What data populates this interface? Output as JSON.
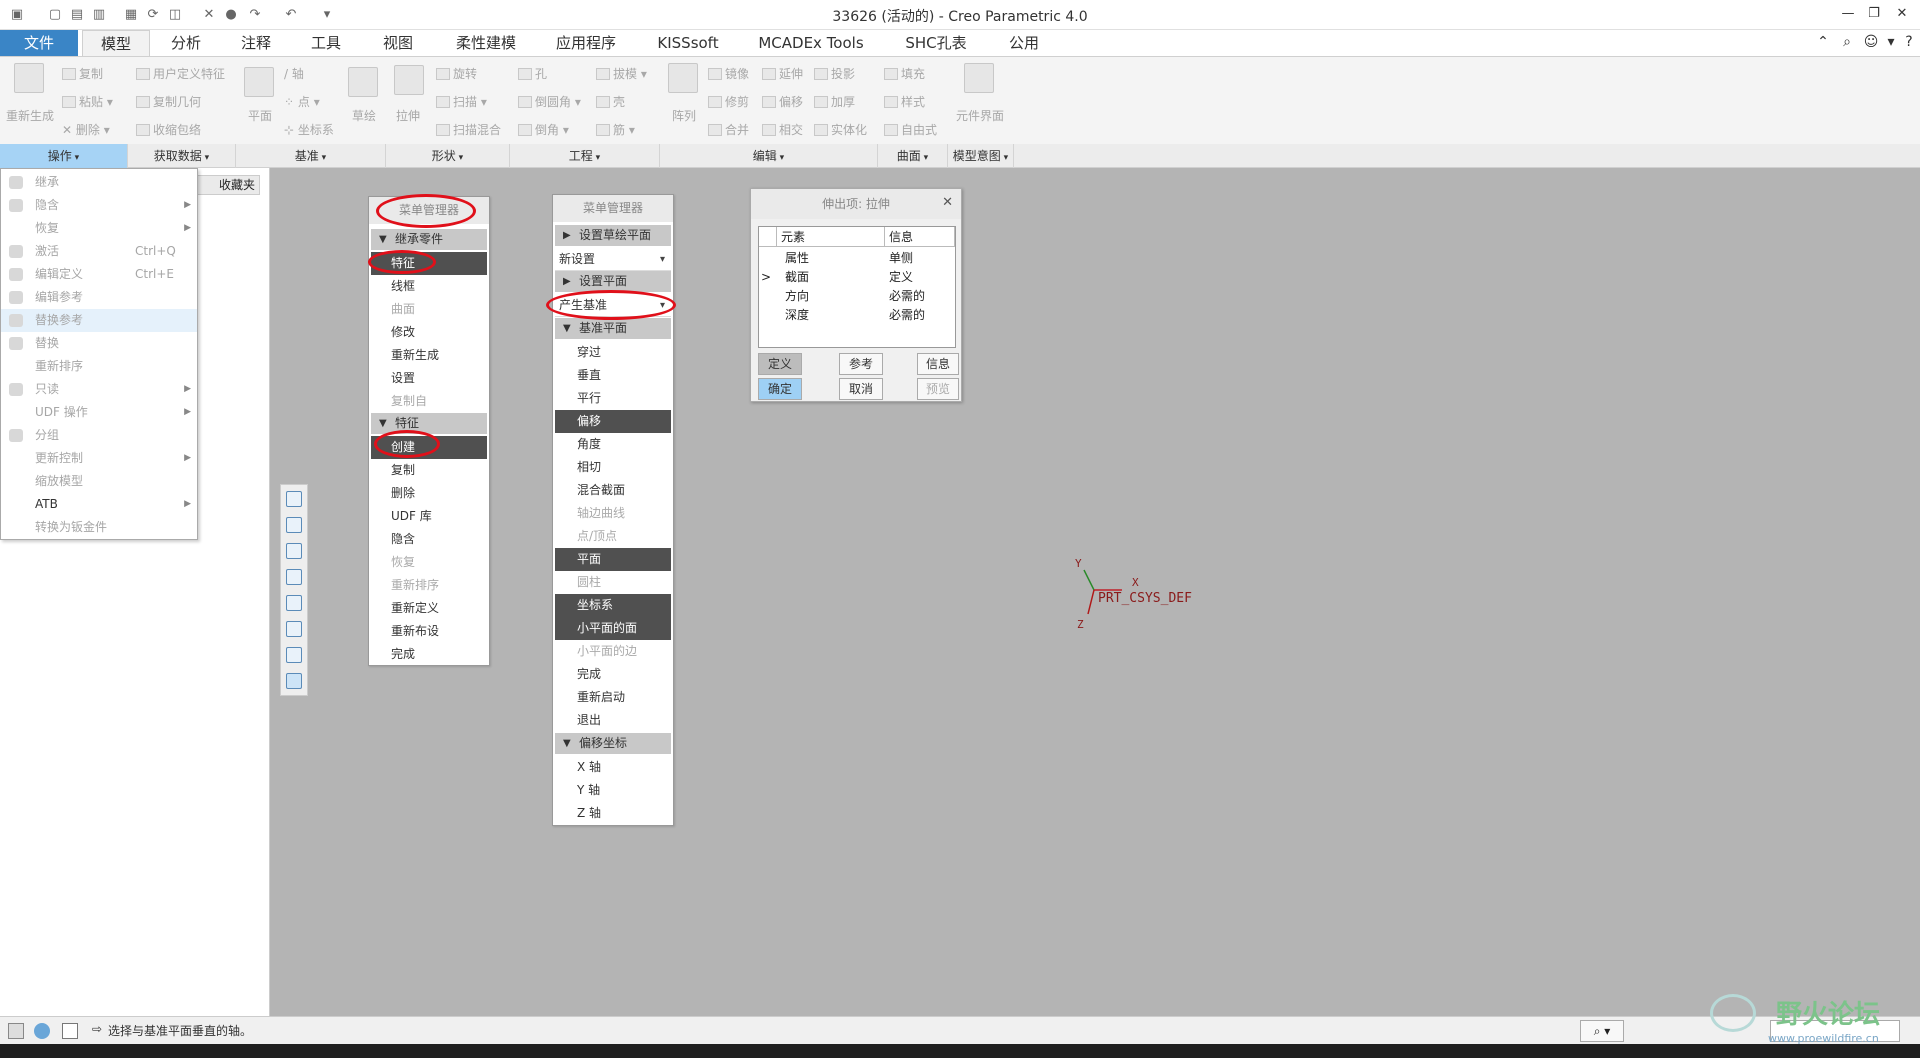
{
  "window": {
    "title": "33626 (活动的) - Creo Parametric 4.0"
  },
  "tabs": [
    "文件",
    "模型",
    "分析",
    "注释",
    "工具",
    "视图",
    "柔性建模",
    "应用程序",
    "KISSsoft",
    "MCADEx Tools",
    "SHC孔表",
    "公用"
  ],
  "ribbon": {
    "regen": "重新生成",
    "copy": "复制",
    "paste": "粘贴",
    "delete": "删除",
    "udf": "用户定义特征",
    "copy_geom": "复制几何",
    "shrinkwrap": "收缩包络",
    "plane": "平面",
    "axis": "轴",
    "point": "点",
    "csys": "坐标系",
    "sketch": "草绘",
    "extrude": "拉伸",
    "revolve": "旋转",
    "sweep": "扫描",
    "swept_blend": "扫描混合",
    "hole": "孔",
    "round": "倒圆角",
    "chamfer": "倒角",
    "draft": "拔模",
    "shell": "壳",
    "rib": "筋",
    "pattern": "阵列",
    "mirror": "镜像",
    "extend": "延伸",
    "project": "投影",
    "trim": "修剪",
    "offset": "偏移",
    "thicken": "加厚",
    "merge": "合并",
    "intersect": "相交",
    "solidify": "实体化",
    "fill": "填充",
    "style": "样式",
    "freestyle": "自由式",
    "comp_interface": "元件界面"
  },
  "groups": [
    "操作",
    "获取数据",
    "基准",
    "形状",
    "工程",
    "编辑",
    "曲面",
    "模型意图"
  ],
  "favorites_tab": "收藏夹",
  "ops_menu": [
    {
      "label": "继承",
      "shortcut": "",
      "arrow": false,
      "enabled": false
    },
    {
      "label": "隐含",
      "shortcut": "",
      "arrow": true,
      "enabled": false
    },
    {
      "label": "恢复",
      "shortcut": "",
      "arrow": true,
      "enabled": false
    },
    {
      "label": "激活",
      "shortcut": "Ctrl+Q",
      "arrow": false,
      "enabled": false
    },
    {
      "label": "编辑定义",
      "shortcut": "Ctrl+E",
      "arrow": false,
      "enabled": false
    },
    {
      "label": "编辑参考",
      "shortcut": "",
      "arrow": false,
      "enabled": false
    },
    {
      "label": "替换参考",
      "shortcut": "",
      "arrow": false,
      "enabled": false
    },
    {
      "label": "替换",
      "shortcut": "",
      "arrow": false,
      "enabled": false
    },
    {
      "label": "重新排序",
      "shortcut": "",
      "arrow": false,
      "enabled": false
    },
    {
      "label": "只读",
      "shortcut": "",
      "arrow": true,
      "enabled": false
    },
    {
      "label": "UDF 操作",
      "shortcut": "",
      "arrow": true,
      "enabled": false
    },
    {
      "label": "分组",
      "shortcut": "",
      "arrow": false,
      "enabled": false
    },
    {
      "label": "更新控制",
      "shortcut": "",
      "arrow": true,
      "enabled": false
    },
    {
      "label": "缩放模型",
      "shortcut": "",
      "arrow": false,
      "enabled": false
    },
    {
      "label": "ATB",
      "shortcut": "",
      "arrow": true,
      "enabled": true
    },
    {
      "label": "转换为钣金件",
      "shortcut": "",
      "arrow": false,
      "enabled": false
    }
  ],
  "menu1": {
    "header": "菜单管理器",
    "section1": "继承零件",
    "items1": [
      {
        "label": "特征",
        "state": "sel"
      },
      {
        "label": "线框",
        "state": ""
      },
      {
        "label": "曲面",
        "state": "dis"
      },
      {
        "label": "修改",
        "state": ""
      },
      {
        "label": "重新生成",
        "state": ""
      },
      {
        "label": "设置",
        "state": ""
      },
      {
        "label": "复制自",
        "state": "dis"
      }
    ],
    "section2": "特征",
    "items2": [
      {
        "label": "创建",
        "state": "sel"
      },
      {
        "label": "复制",
        "state": ""
      },
      {
        "label": "删除",
        "state": ""
      },
      {
        "label": "UDF 库",
        "state": ""
      },
      {
        "label": "隐含",
        "state": ""
      },
      {
        "label": "恢复",
        "state": "dis"
      },
      {
        "label": "重新排序",
        "state": "dis"
      },
      {
        "label": "重新定义",
        "state": ""
      },
      {
        "label": "重新布设",
        "state": ""
      },
      {
        "label": "完成",
        "state": ""
      }
    ]
  },
  "menu2": {
    "header": "菜单管理器",
    "sec_sketch_plane": "设置草绘平面",
    "dd1": "新设置",
    "sec_set_plane": "设置平面",
    "dd2": "产生基准",
    "sec_datum_plane": "基准平面",
    "items": [
      {
        "label": "穿过",
        "state": ""
      },
      {
        "label": "垂直",
        "state": ""
      },
      {
        "label": "平行",
        "state": ""
      },
      {
        "label": "偏移",
        "state": "sel"
      },
      {
        "label": "角度",
        "state": ""
      },
      {
        "label": "相切",
        "state": ""
      },
      {
        "label": "混合截面",
        "state": ""
      },
      {
        "label": "轴边曲线",
        "state": "dis"
      },
      {
        "label": "点/顶点",
        "state": "dis"
      },
      {
        "label": "平面",
        "state": "sel"
      },
      {
        "label": "圆柱",
        "state": "dis"
      },
      {
        "label": "坐标系",
        "state": "sel"
      },
      {
        "label": "小平面的面",
        "state": "sel"
      },
      {
        "label": "小平面的边",
        "state": "dis"
      },
      {
        "label": "完成",
        "state": ""
      },
      {
        "label": "重新启动",
        "state": ""
      },
      {
        "label": "退出",
        "state": ""
      }
    ],
    "sec_offset_csys": "偏移坐标",
    "axes": [
      "X 轴",
      "Y 轴",
      "Z 轴"
    ]
  },
  "extrude_dialog": {
    "title": "伸出项: 拉伸",
    "col_element": "元素",
    "col_info": "信息",
    "rows": [
      {
        "marker": "",
        "element": "属性",
        "info": "单侧"
      },
      {
        "marker": ">",
        "element": "截面",
        "info": "定义"
      },
      {
        "marker": "",
        "element": "方向",
        "info": "必需的"
      },
      {
        "marker": "",
        "element": "深度",
        "info": "必需的"
      }
    ],
    "btn_define": "定义",
    "btn_refs": "参考",
    "btn_info": "信息",
    "btn_ok": "确定",
    "btn_cancel": "取消",
    "btn_preview": "预览"
  },
  "csys": {
    "label": "PRT_CSYS_DEF",
    "x": "X",
    "y": "Y",
    "z": "Z"
  },
  "status": {
    "message": "选择与基准平面垂直的轴。"
  },
  "watermark": {
    "text": "野火论坛",
    "url": "www.proewildfire.cn"
  },
  "colors": {
    "accent": "#3a85c6",
    "highlight": "#e0101a"
  }
}
